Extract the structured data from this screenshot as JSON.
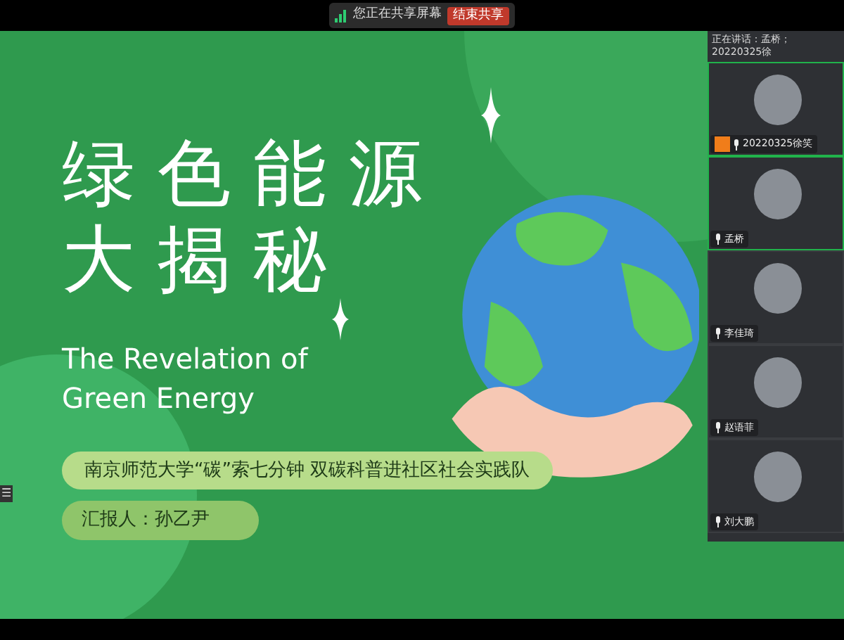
{
  "share_bar": {
    "status": "您正在共享屏幕",
    "stop_button": "结束共享"
  },
  "slide": {
    "title_lines": [
      "绿色能源",
      "大揭秘"
    ],
    "subtitle_lines": [
      "The Revelation of",
      "Green Energy"
    ],
    "team": "南京师范大学“碳”索七分钟 双碳科普进社区社会实践队",
    "presenter": "汇报人：孙乙尹"
  },
  "side_toggle": "☰",
  "speaking_bar": "正在讲话：孟桥；20220325徐",
  "participants": [
    {
      "name": "20220325徐笑",
      "host": true,
      "highlighted": true
    },
    {
      "name": "孟桥",
      "host": false,
      "highlighted": true
    },
    {
      "name": "李佳琦",
      "host": false,
      "highlighted": false
    },
    {
      "name": "赵语菲",
      "host": false,
      "highlighted": false
    },
    {
      "name": "刘大鹏",
      "host": false,
      "highlighted": false
    }
  ]
}
